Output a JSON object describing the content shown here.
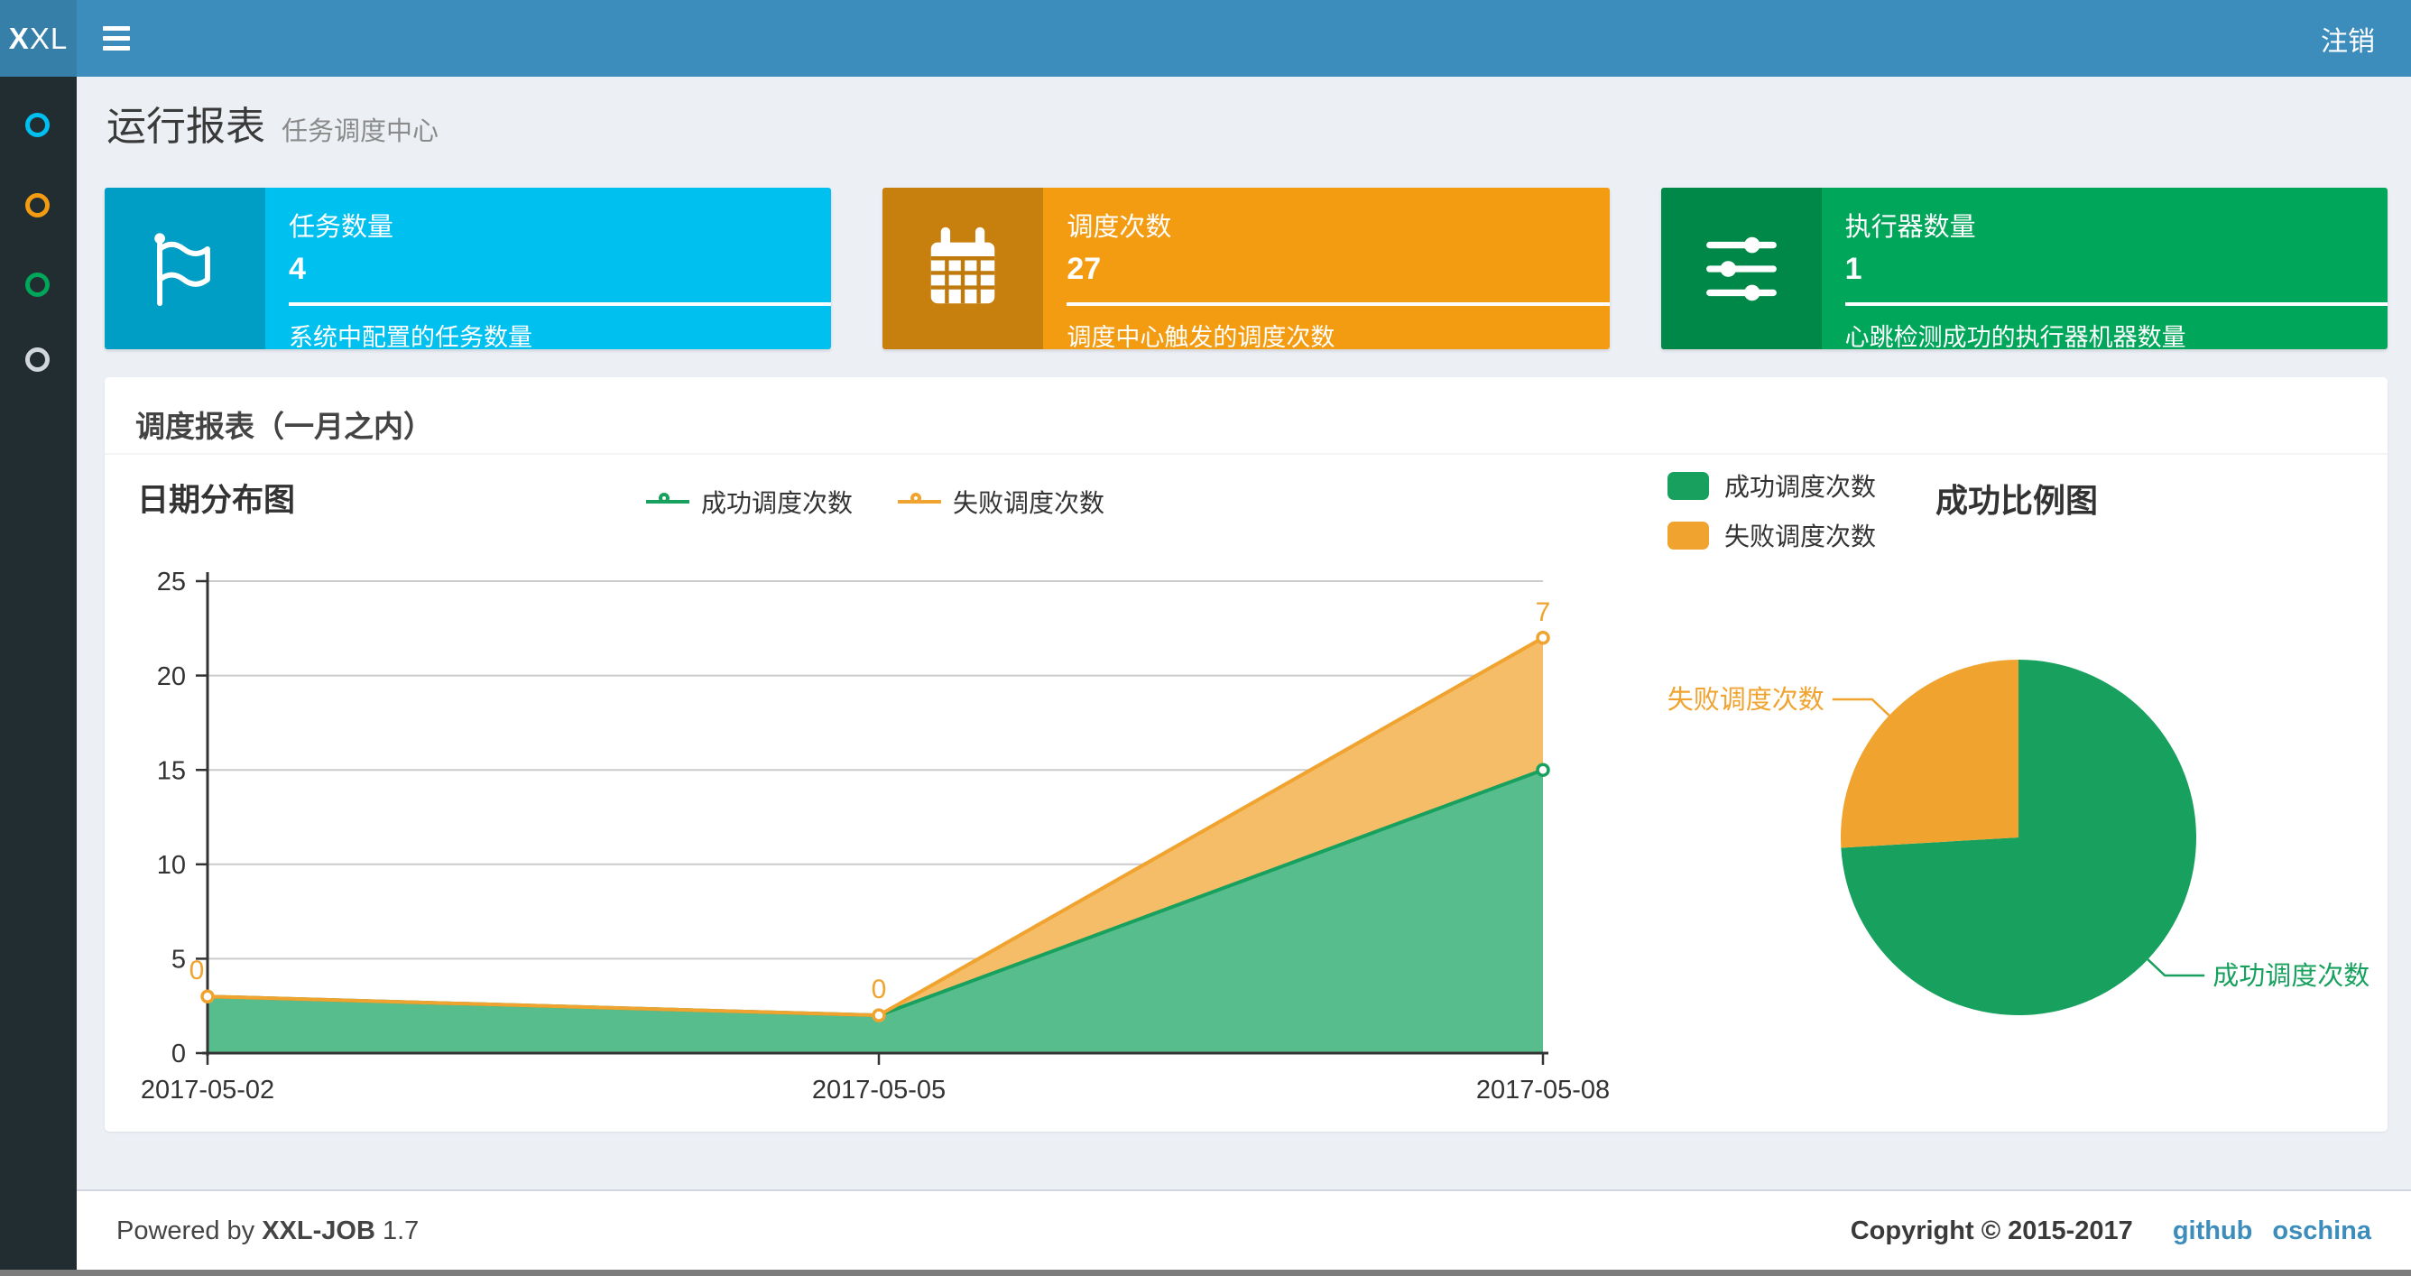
{
  "theme": {
    "navbar": "#3c8dbc",
    "logo": "#367fa9",
    "sidebar": "#222d32",
    "page_bg": "#ecf0f5",
    "link": "#3c8dbc",
    "footer_border": "#d2d6de"
  },
  "navbar": {
    "logo_bold": "X",
    "logo_light": "XL",
    "logout_label": "注销"
  },
  "sidebar": {
    "items": [
      {
        "color": "#00c0ef"
      },
      {
        "color": "#f39c12"
      },
      {
        "color": "#00a65a"
      },
      {
        "color": "#d2d6de"
      }
    ]
  },
  "header": {
    "title": "运行报表",
    "subtitle": "任务调度中心"
  },
  "info_boxes": [
    {
      "label": "任务数量",
      "value": "4",
      "description": "系统中配置的任务数量",
      "color": "#00c0ef",
      "icon": "flag-icon"
    },
    {
      "label": "调度次数",
      "value": "27",
      "description": "调度中心触发的调度次数",
      "color": "#f39c12",
      "icon": "calendar-icon"
    },
    {
      "label": "执行器数量",
      "value": "1",
      "description": "心跳检测成功的执行器机器数量",
      "color": "#00a65a",
      "icon": "sliders-icon"
    }
  ],
  "panel": {
    "title": "调度报表（一月之内）"
  },
  "chart_data": [
    {
      "type": "area",
      "title": "日期分布图",
      "categories": [
        "2017-05-02",
        "2017-05-05",
        "2017-05-08"
      ],
      "series": [
        {
          "name": "成功调度次数",
          "values": [
            3,
            2,
            15
          ],
          "color": "#18a05e",
          "fill": "#58bd8d"
        },
        {
          "name": "失败调度次数",
          "values": [
            0,
            0,
            7
          ],
          "color": "#f0a32f",
          "fill": "#f5bd68"
        }
      ],
      "stacked": true,
      "point_labels_series": "失败调度次数",
      "point_labels": [
        0,
        0,
        7
      ],
      "ylim": [
        0,
        25
      ],
      "yticks": [
        0,
        5,
        10,
        15,
        20,
        25
      ],
      "grid": true,
      "legend_position": "top"
    },
    {
      "type": "pie",
      "title": "成功比例图",
      "slices": [
        {
          "label": "成功调度次数",
          "value": 20,
          "color": "#18a05e"
        },
        {
          "label": "失败调度次数",
          "value": 7,
          "color": "#f0a32f"
        }
      ],
      "start_angle_deg": -90,
      "direction": "clockwise",
      "legend_position": "top-left"
    }
  ],
  "footer": {
    "powered_prefix": "Powered by",
    "brand": "XXL-JOB",
    "version": "1.7",
    "copyright": "Copyright © 2015-2017",
    "links": [
      "github",
      "oschina"
    ]
  }
}
